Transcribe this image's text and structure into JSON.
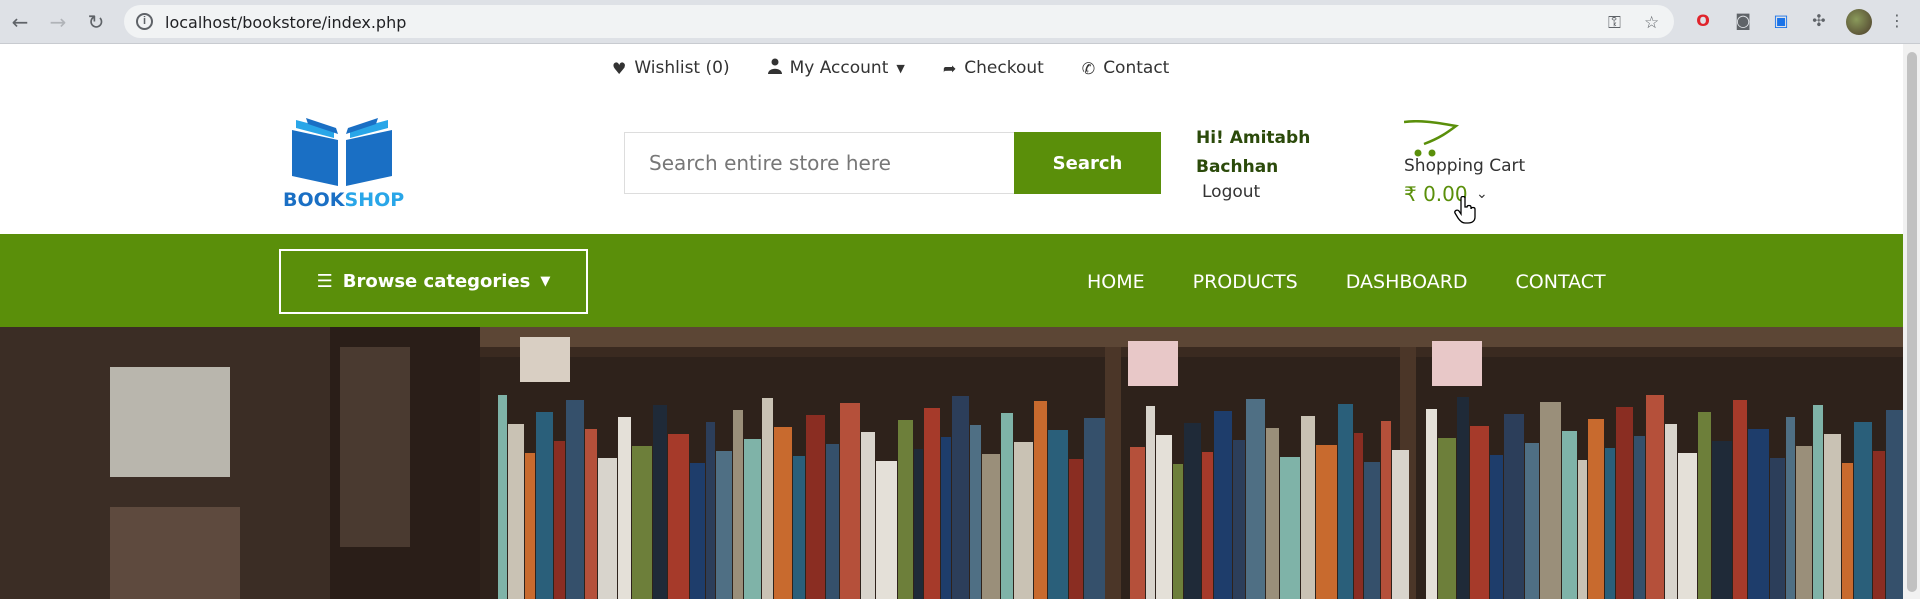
{
  "browser": {
    "url": "localhost/bookstore/index.php",
    "icons": [
      "back-icon",
      "forward-icon",
      "reload-icon",
      "info-icon",
      "key-icon",
      "star-icon",
      "opera-icon",
      "camera-icon",
      "screen-icon",
      "puzzle-icon",
      "avatar",
      "menu-dots-icon"
    ]
  },
  "toplinks": {
    "wishlist": "Wishlist (0)",
    "account": "My Account",
    "checkout": "Checkout",
    "contact": "Contact"
  },
  "logo": {
    "part1": "BOOK",
    "part2": "SHOP"
  },
  "search": {
    "placeholder": "Search entire store here",
    "button": "Search"
  },
  "user": {
    "line1": "Hi! Amitabh",
    "line2": "Bachhan",
    "logout": "Logout"
  },
  "cart": {
    "label": "Shopping Cart",
    "total": "₹ 0.00"
  },
  "nav": {
    "browse": "Browse categories",
    "items": [
      "HOME",
      "PRODUCTS",
      "DASHBOARD",
      "CONTACT"
    ]
  },
  "colors": {
    "brand_green": "#5a8f0a",
    "logo_blue": "#1a6fc4",
    "logo_light_blue": "#29a6e8"
  }
}
